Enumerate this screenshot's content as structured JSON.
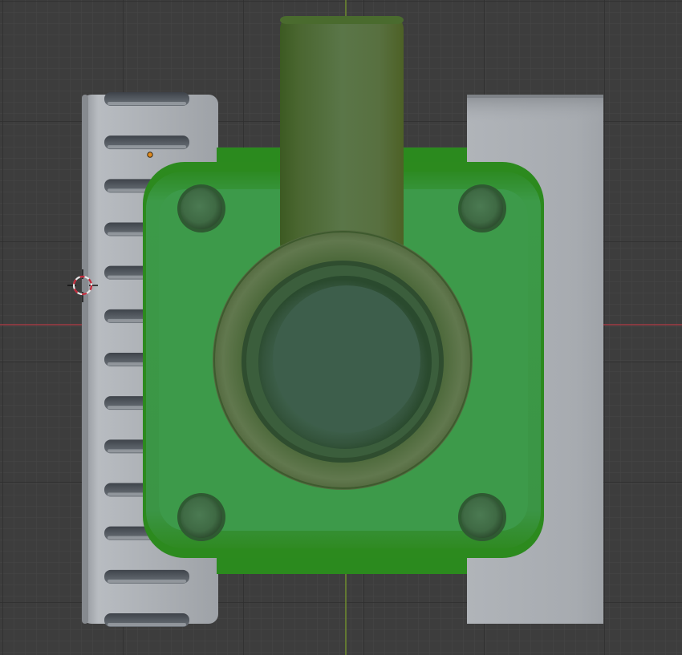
{
  "viewport": {
    "background": "#3d3d3d",
    "grid_minor_color": "#444444",
    "grid_major_color": "#262626",
    "x_axis_color": "#9e3b45",
    "y_axis_color": "#6e8b2e",
    "cursor_colors": [
      "#e8e8e8",
      "#c4283a"
    ],
    "origin_marker_color": "#e08a1e"
  },
  "model": {
    "parts": [
      {
        "name": "heatsink-left",
        "color": "#a6aaaf",
        "fin_color": "#4a4f56",
        "fin_count": 13
      },
      {
        "name": "bracket-right",
        "color": "#a8acb2"
      },
      {
        "name": "green-body",
        "color": "#3a9a44",
        "edge_color": "#2c8a1e"
      },
      {
        "name": "nozzle-pipe",
        "color": "#4c6a31"
      },
      {
        "name": "circular-port",
        "color": "#557046",
        "inner_color": "#3b5a48"
      },
      {
        "name": "mount-screws",
        "count": 4,
        "color": "#4a7a4f"
      }
    ]
  }
}
